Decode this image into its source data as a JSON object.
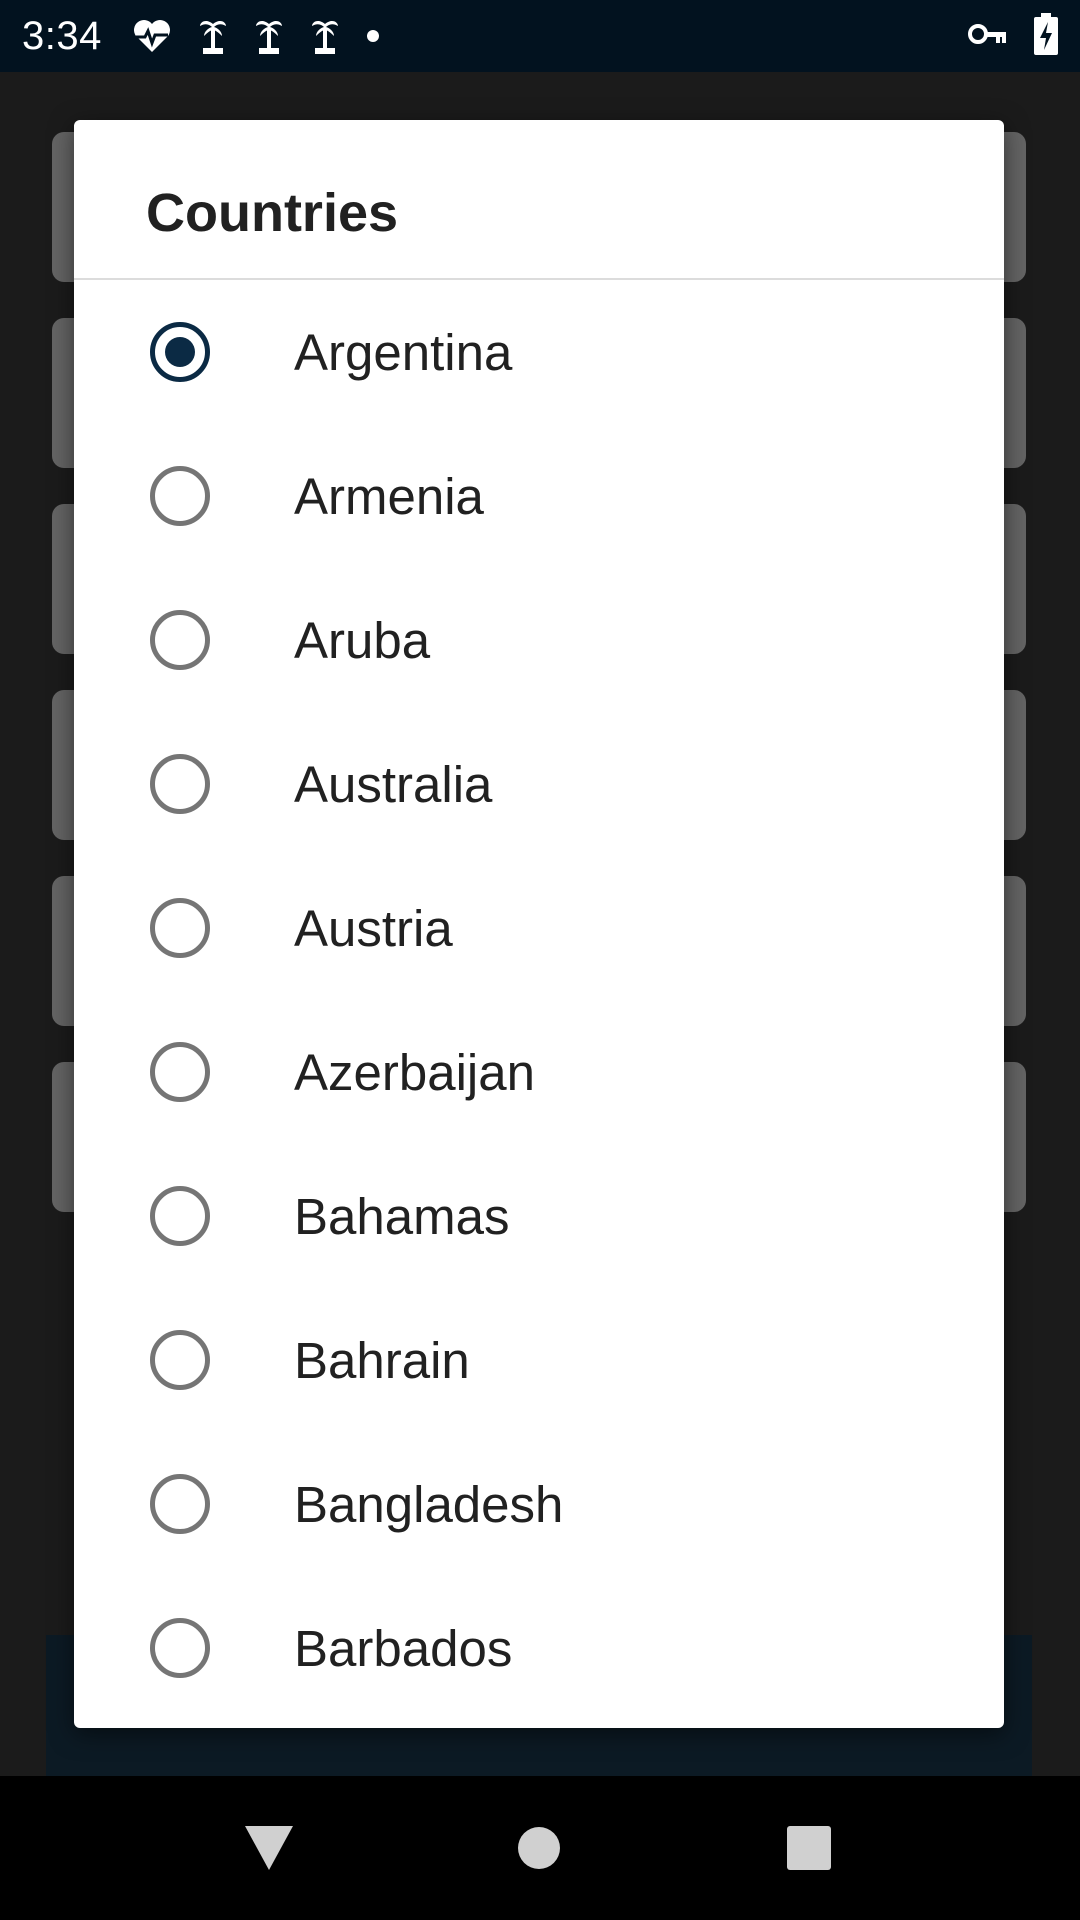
{
  "status_bar": {
    "time": "3:34",
    "left_icons": [
      "heart-pulse-icon",
      "palm-tree-icon",
      "palm-tree-icon",
      "palm-tree-icon",
      "dot-icon"
    ],
    "right_icons": [
      "vpn-key-icon",
      "battery-charging-icon"
    ]
  },
  "dialog": {
    "title": "Countries",
    "selected": "Argentina",
    "options": [
      {
        "label": "Argentina",
        "checked": true
      },
      {
        "label": "Armenia",
        "checked": false
      },
      {
        "label": "Aruba",
        "checked": false
      },
      {
        "label": "Australia",
        "checked": false
      },
      {
        "label": "Austria",
        "checked": false
      },
      {
        "label": "Azerbaijan",
        "checked": false
      },
      {
        "label": "Bahamas",
        "checked": false
      },
      {
        "label": "Bahrain",
        "checked": false
      },
      {
        "label": "Bangladesh",
        "checked": false
      },
      {
        "label": "Barbados",
        "checked": false
      }
    ]
  },
  "nav_bar": {
    "buttons": [
      "back-icon",
      "home-icon",
      "recents-icon"
    ]
  },
  "colors": {
    "accent": "#0b2a44",
    "status_bar": "#02121f",
    "scrim": "#1b1b1b"
  }
}
